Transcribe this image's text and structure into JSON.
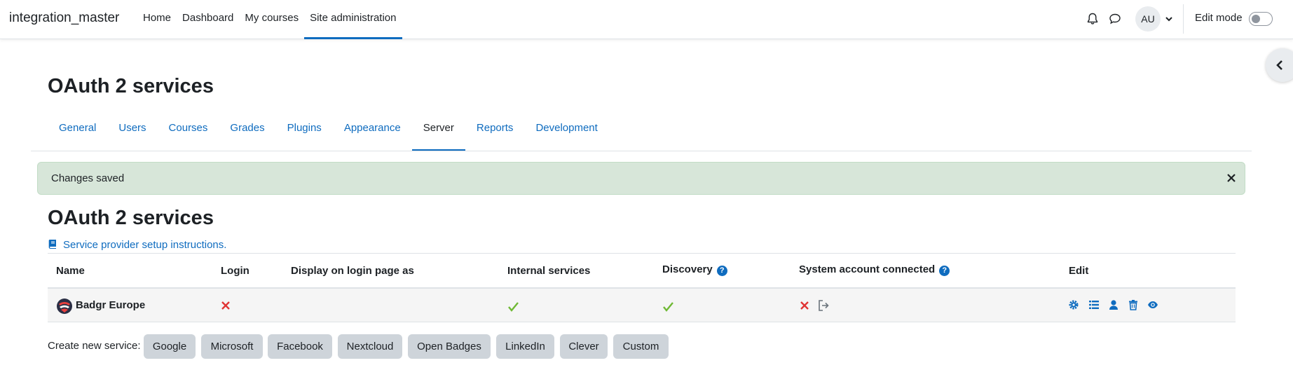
{
  "navbar": {
    "brand": "integration_master",
    "items": [
      {
        "label": "Home"
      },
      {
        "label": "Dashboard"
      },
      {
        "label": "My courses"
      },
      {
        "label": "Site administration",
        "active": true
      }
    ],
    "user_initials": "AU",
    "edit_mode_label": "Edit mode",
    "edit_mode_on": false
  },
  "page": {
    "heading": "OAuth 2 services"
  },
  "secondary_nav": {
    "tabs": [
      {
        "label": "General"
      },
      {
        "label": "Users"
      },
      {
        "label": "Courses"
      },
      {
        "label": "Grades"
      },
      {
        "label": "Plugins"
      },
      {
        "label": "Appearance"
      },
      {
        "label": "Server",
        "active": true
      },
      {
        "label": "Reports"
      },
      {
        "label": "Development"
      }
    ]
  },
  "alert": {
    "message": "Changes saved",
    "close_icon": "close-icon"
  },
  "main": {
    "heading": "OAuth 2 services",
    "instructions_link": "Service provider setup instructions.",
    "instructions_icon": "book-icon"
  },
  "table": {
    "headers": {
      "name": "Name",
      "login": "Login",
      "display": "Display on login page as",
      "internal": "Internal services",
      "discovery": "Discovery",
      "system_account": "System account connected",
      "edit": "Edit"
    },
    "rows": [
      {
        "name": "Badgr Europe",
        "login": "disabled",
        "display": "",
        "internal": "yes",
        "discovery": "yes",
        "system_account": "no"
      }
    ],
    "edit_icons": [
      "gear-icon",
      "list-icon",
      "user-icon",
      "trash-icon",
      "eye-icon"
    ]
  },
  "create_service": {
    "label": "Create new service:",
    "buttons": [
      "Google",
      "Microsoft",
      "Facebook",
      "Nextcloud",
      "Open Badges",
      "LinkedIn",
      "Clever",
      "Custom"
    ]
  },
  "colors": {
    "link": "#0f6cbf",
    "alert_bg": "#d7e6d9",
    "cross": "#e03535",
    "check": "#6fb934",
    "button_bg": "#ced4da"
  }
}
